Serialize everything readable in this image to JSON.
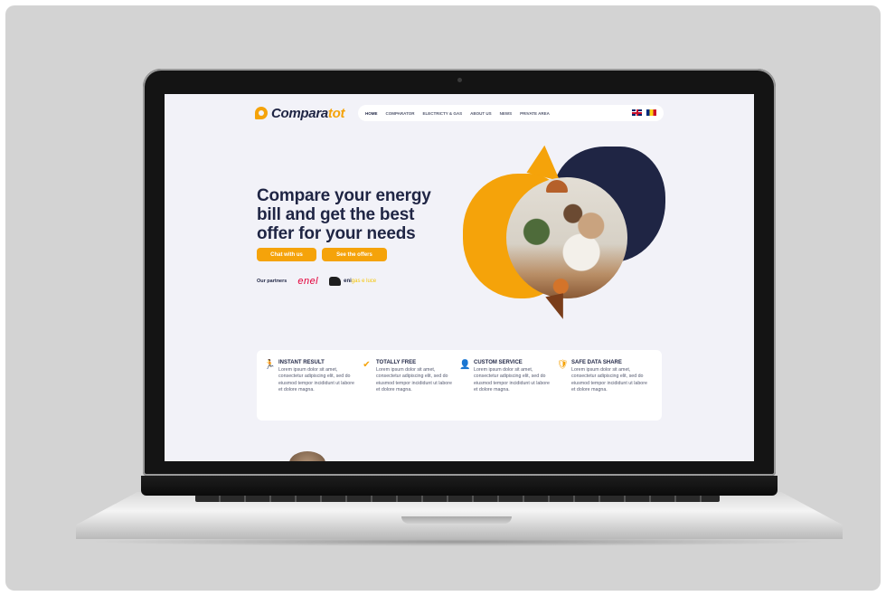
{
  "site": {
    "logo": {
      "part1": "Compara",
      "part2": "tot"
    },
    "nav": {
      "items": [
        "HOME",
        "COMPARATOR",
        "ELECTRICTY & GAS",
        "ABOUT US",
        "NEWS",
        "PRIVATE AREA"
      ],
      "active": "HOME",
      "flags": [
        "uk-flag",
        "romania-flag"
      ]
    },
    "hero": {
      "title": "Compare your energy bill and get the best offer for your needs",
      "btn_chat": "Chat with us",
      "btn_offers": "See the offers"
    },
    "partners": {
      "label": "Our partners",
      "enel": "enel",
      "eni_prefix": "eni",
      "eni_suffix": "gas e luce"
    },
    "features": [
      {
        "icon": "running-person-icon",
        "title": "INSTANT RESULT",
        "desc": "Lorem ipsum dolor sit amet, consectetur adipiscing elit, sed do eiusmod tempor incididunt ut labore et dolore magna."
      },
      {
        "icon": "checkmark-icon",
        "title": "TOTALLY FREE",
        "desc": "Lorem ipsum dolor sit amet, consectetur adipiscing elit, sed do eiusmod tempor incididunt ut labore et dolore magna."
      },
      {
        "icon": "user-check-icon",
        "title": "CUSTOM SERVICE",
        "desc": "Lorem ipsum dolor sit amet, consectetur adipiscing elit, sed do eiusmod tempor incididunt ut labore et dolore magna."
      },
      {
        "icon": "shield-icon",
        "title": "SAFE DATA SHARE",
        "desc": "Lorem ipsum dolor sit amet, consectetur adipiscing elit, sed do eiusmod tempor incididunt ut labore et dolore magna."
      }
    ]
  },
  "colors": {
    "accent": "#f5a30a",
    "navy": "#1f2544",
    "background": "#f2f2f8",
    "stage": "#d3d3d3"
  }
}
